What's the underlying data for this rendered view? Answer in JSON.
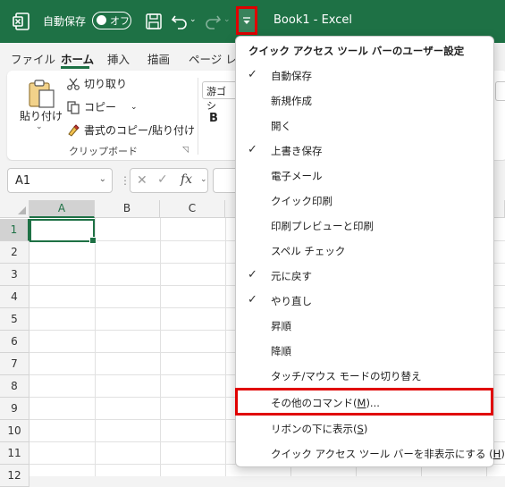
{
  "title_bar": {
    "autosave_label": "自動保存",
    "autosave_toggle": "オフ",
    "document_title": "Book1  -  Excel",
    "background": "#1e7145"
  },
  "tabs": [
    "ファイル",
    "ホーム",
    "挿入",
    "描画",
    "ページ レ"
  ],
  "active_tab": "ホーム",
  "ribbon": {
    "paste_label": "貼り付け",
    "cut_label": "切り取り",
    "copy_label": "コピー",
    "format_painter_label": "書式のコピー/貼り付け",
    "clipboard_group": "クリップボード",
    "font_name": "游ゴシ",
    "bold_label": "B"
  },
  "formula_bar": {
    "name_box": "A1",
    "fx_label": "fx"
  },
  "columns": [
    "A",
    "B",
    "C"
  ],
  "rows": [
    "1",
    "2",
    "3",
    "4",
    "5",
    "6",
    "7",
    "8",
    "9",
    "10",
    "11",
    "12"
  ],
  "selected_cell": "A1",
  "qat_menu": {
    "title": "クイック アクセス ツール バーのユーザー設定",
    "items": [
      {
        "label": "自動保存",
        "checked": "✓"
      },
      {
        "label": "新規作成",
        "checked": ""
      },
      {
        "label": "開く",
        "checked": ""
      },
      {
        "label": "上書き保存",
        "checked": "✓"
      },
      {
        "label": "電子メール",
        "checked": ""
      },
      {
        "label": "クイック印刷",
        "checked": ""
      },
      {
        "label": "印刷プレビューと印刷",
        "checked": ""
      },
      {
        "label": "スペル チェック",
        "checked": ""
      },
      {
        "label": "元に戻す",
        "checked": "✓"
      },
      {
        "label": "やり直し",
        "checked": "✓"
      },
      {
        "label": "昇順",
        "checked": ""
      },
      {
        "label": "降順",
        "checked": ""
      },
      {
        "label": "タッチ/マウス モードの切り替え",
        "checked": ""
      }
    ],
    "more_commands": {
      "pre": "その他のコマンド(",
      "key": "M",
      "post": ")..."
    },
    "show_below": {
      "pre": "リボンの下に表示(",
      "key": "S",
      "post": ")"
    },
    "hide_qat": {
      "pre": "クイック アクセス ツール バーを非表示にする (",
      "key": "H",
      "post": ")"
    }
  },
  "highlight_color": "#e00000"
}
